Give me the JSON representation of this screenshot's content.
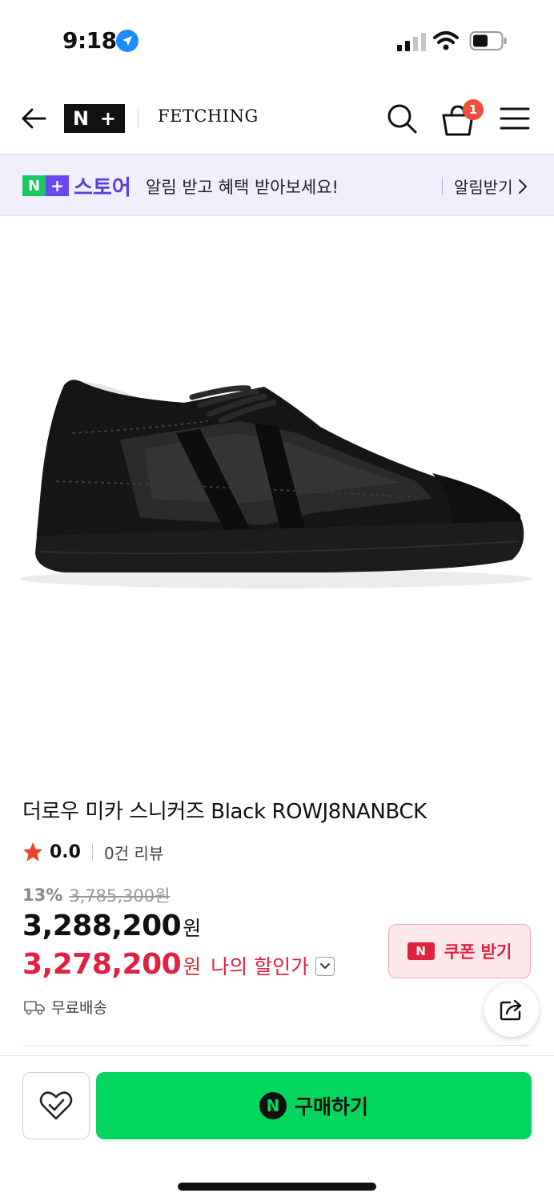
{
  "status_bar": {
    "time": "9:18"
  },
  "header": {
    "logo_n": "N",
    "logo_plus": "+",
    "store_name": "FETCHING",
    "cart_count": "1"
  },
  "promo": {
    "logo_n": "N",
    "logo_plus": "+",
    "store_word": "스토어",
    "text": "알림 받고 혜택 받아보세요!",
    "action": "알림받기"
  },
  "product": {
    "title": "더로우 미카 스니커즈 Black ROWJ8NANBCK",
    "rating": "0.0",
    "review_count": "0건 리뷰",
    "discount_percent": "13%",
    "original_price": "3,785,300원",
    "price": "3,288,200",
    "price_unit": "원",
    "my_price": "3,278,200",
    "my_price_unit": "원",
    "my_price_label": "나의 할인가",
    "coupon_label": "쿠폰 받기",
    "coupon_icon_text": "N",
    "shipping": "무료배송"
  },
  "bottom_bar": {
    "buy_label": "구매하기",
    "buy_icon_text": "N"
  },
  "colors": {
    "naver_green": "#03d65e",
    "store_purple": "#5b3de0",
    "sale_red": "#e0213f",
    "badge_red": "#f04e3a"
  },
  "icons": [
    "location-arrow-icon",
    "signal-icon",
    "wifi-icon",
    "battery-icon",
    "back-arrow-icon",
    "search-icon",
    "cart-icon",
    "hamburger-menu-icon",
    "chevron-right-icon",
    "star-icon",
    "chevron-down-icon",
    "truck-icon",
    "share-icon",
    "heart-check-icon"
  ]
}
